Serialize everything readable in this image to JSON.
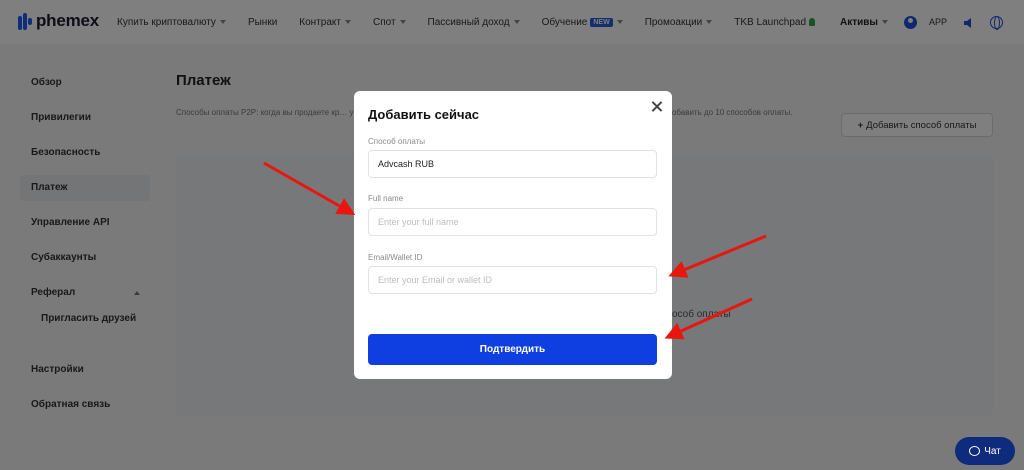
{
  "header": {
    "logo_text": "phemex",
    "nav": [
      {
        "label": "Купить криптовалюту",
        "has_caret": true
      },
      {
        "label": "Рынки",
        "has_caret": false
      },
      {
        "label": "Контракт",
        "has_caret": true
      },
      {
        "label": "Спот",
        "has_caret": true
      },
      {
        "label": "Пассивный доход",
        "has_caret": true
      },
      {
        "label": "Обучение",
        "badge": "NEW",
        "has_caret": true
      },
      {
        "label": "Промоакции",
        "has_caret": true
      },
      {
        "label": "TKB Launchpad",
        "has_caret": false
      }
    ],
    "assets_label": "Активы",
    "app_label": "APP",
    "icons": [
      "user-icon",
      "sound-icon",
      "globe-icon"
    ]
  },
  "sidebar": {
    "items": [
      {
        "label": "Обзор"
      },
      {
        "label": "Привилегии"
      },
      {
        "label": "Безопасность"
      },
      {
        "label": "Платеж",
        "active": true
      },
      {
        "label": "Управление API"
      },
      {
        "label": "Субаккаунты"
      },
      {
        "label": "Реферал",
        "expanded": true
      }
    ],
    "sub_items": [
      {
        "label": "Пригласить друзей"
      }
    ],
    "bottom_items": [
      {
        "label": "Настройки"
      },
      {
        "label": "Обратная связь"
      }
    ]
  },
  "main": {
    "title": "Платеж",
    "description": "Способы оплаты P2P: когда вы продаете кр… упателя в качестве способа принятия платежа. Убедитесь, что имя влад… ы можете добавить до 10 способов оплаты.",
    "add_button_label": "Добавить способ оплаты",
    "empty_text": "особ оплаты"
  },
  "modal": {
    "title": "Добавить сейчас",
    "payment_method_label": "Способ оплаты",
    "payment_method_value": "Advcash RUB",
    "full_name_label": "Full name",
    "full_name_placeholder": "Enter your full name",
    "email_label": "Email/Wallet ID",
    "email_placeholder": "Enter your Email or wallet ID",
    "confirm_label": "Подтвердить"
  },
  "chat": {
    "label": "Чат"
  },
  "colors": {
    "brand_blue": "#0f3fe0",
    "arrow_red": "#e8160f",
    "chat_bg": "#0f2b7e"
  }
}
